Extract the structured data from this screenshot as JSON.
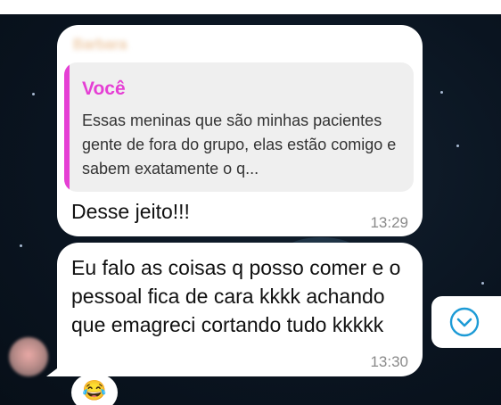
{
  "chat": {
    "messages": [
      {
        "sender": "Barbara",
        "reply_to": {
          "author": "Você",
          "text": "Essas meninas que são minhas pacientes gente de fora do grupo, elas estão comigo e sabem exatamente o q..."
        },
        "text": "Desse jeito!!!",
        "time": "13:29"
      },
      {
        "text": "Eu falo as coisas q posso comer e o pessoal fica de cara kkkk achando que emagreci cortando tudo kkkkk",
        "time": "13:30",
        "reaction": "😂"
      }
    ]
  },
  "scroll_button": {
    "icon": "chevron-down-icon"
  },
  "colors": {
    "accent": "#e53fd4",
    "scroll_icon": "#1d9bd6",
    "bubble": "#ffffff"
  }
}
